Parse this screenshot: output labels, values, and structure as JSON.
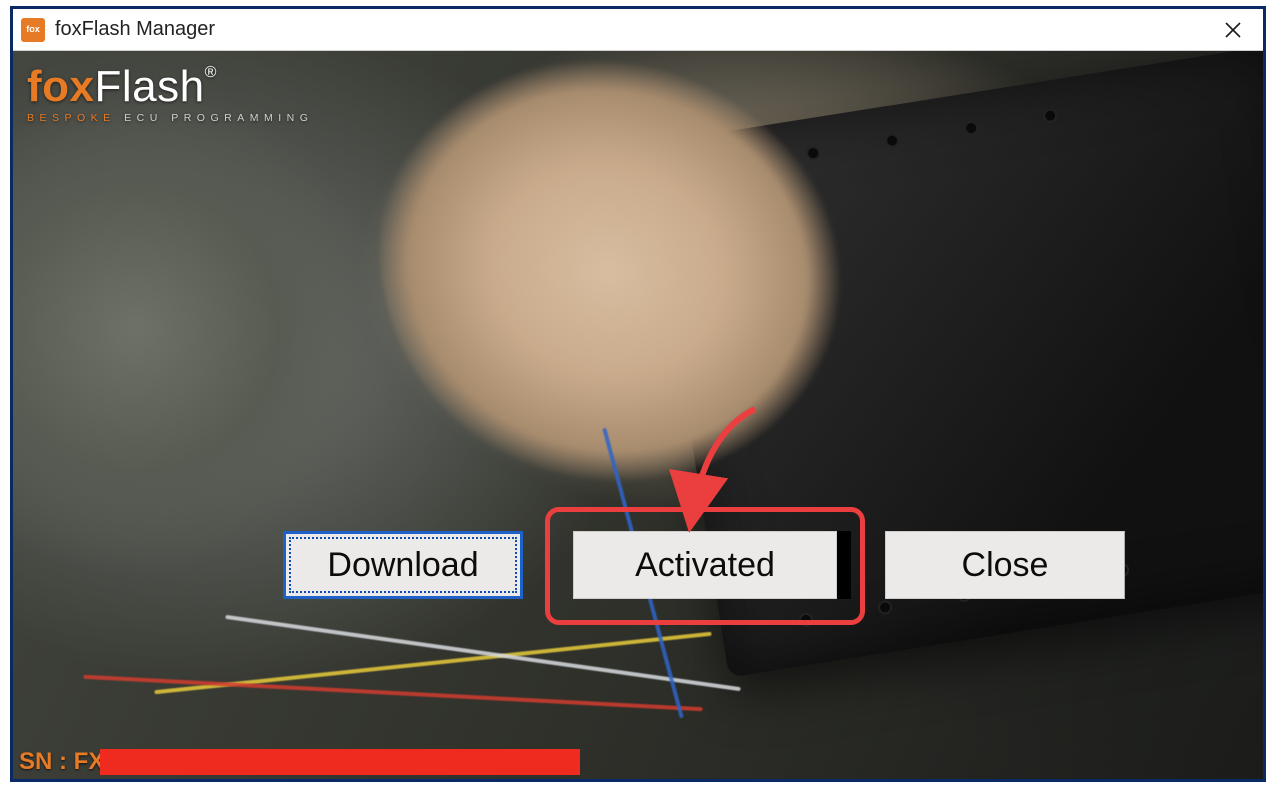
{
  "window": {
    "title": "foxFlash Manager"
  },
  "logo": {
    "brand_prefix": "fox",
    "brand_suffix": "Flash",
    "registered_mark": "®",
    "subline_prefix": "BESPOKE",
    "subline_suffix": " ECU PROGRAMMING"
  },
  "buttons": {
    "download": "Download",
    "activated": "Activated",
    "close": "Close"
  },
  "status": {
    "sn_label": "SN : FX"
  },
  "colors": {
    "accent": "#e77a24",
    "annotation": "#ea3e3f",
    "focus_outline": "#1d62c8",
    "redaction": "#ef2a1f"
  }
}
